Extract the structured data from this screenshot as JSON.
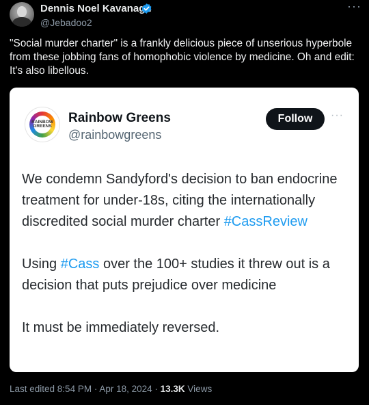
{
  "post": {
    "author_name": "Dennis Noel Kavanagh",
    "author_handle": "@Jebadoo2",
    "more_icon": "more-horizontal-icon",
    "text": "\"Social murder charter\" is a frankly delicious piece of unserious hyperbole from these jobbing fans of homophobic violence by medicine. Oh and edit: It's also libellous."
  },
  "quoted": {
    "name": "Rainbow Greens",
    "handle": "@rainbowgreens",
    "logo_text_1": "RAINBOW",
    "logo_text_2": "GREENS",
    "follow_label": "Follow",
    "para1_before": "We condemn Sandyford's decision to ban endocrine treatment for under-18s, citing the internationally discredited social murder charter ",
    "para1_tag": "#CassReview",
    "para2_before": "Using ",
    "para2_tag": "#Cass",
    "para2_after": " over the 100+ studies it threw out is a decision that puts prejudice over medicine",
    "para3": "It must be immediately reversed."
  },
  "meta": {
    "edited": "Last edited 8:54 PM · Apr 18, 2024 · ",
    "views_count": "13.3K",
    "views_label": " Views"
  },
  "colors": {
    "background": "#000000",
    "hashtag": "#1d9bf0",
    "verified": "#1d9bf0",
    "muted": "#8b98a5"
  }
}
